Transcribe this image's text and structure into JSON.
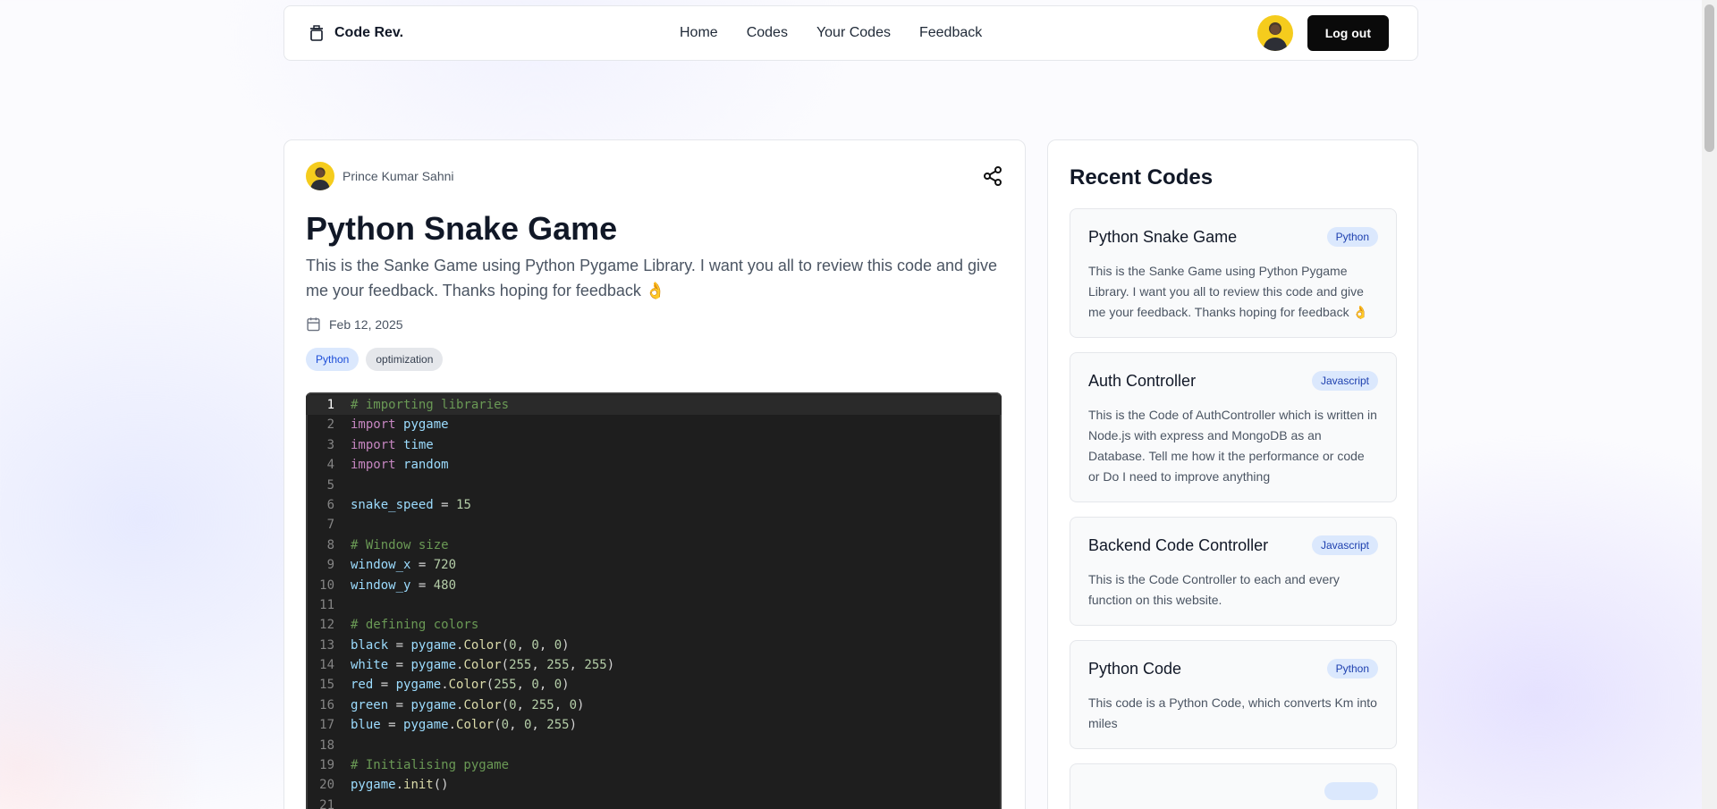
{
  "navbar": {
    "brand": "Code Rev.",
    "brand_icon": "trash-can-icon",
    "links": [
      "Home",
      "Codes",
      "Your Codes",
      "Feedback"
    ],
    "logout_label": "Log out"
  },
  "post": {
    "author": "Prince Kumar Sahni",
    "title": "Python Snake Game",
    "description": "This is the Sanke Game using Python Pygame Library. I want you all to review this code and give me your feedback. Thanks hoping for feedback 👌",
    "date": "Feb 12, 2025",
    "tags": [
      "Python",
      "optimization"
    ],
    "share_icon": "share-icon",
    "date_icon": "calendar-icon"
  },
  "code": {
    "active_line": 1,
    "lines": [
      "# importing libraries",
      "import pygame",
      "import time",
      "import random",
      "",
      "snake_speed = 15",
      "",
      "# Window size",
      "window_x = 720",
      "window_y = 480",
      "",
      "# defining colors",
      "black = pygame.Color(0, 0, 0)",
      "white = pygame.Color(255, 255, 255)",
      "red = pygame.Color(255, 0, 0)",
      "green = pygame.Color(0, 255, 0)",
      "blue = pygame.Color(0, 0, 255)",
      "",
      "# Initialising pygame",
      "pygame.init()",
      ""
    ]
  },
  "sidebar": {
    "title": "Recent Codes",
    "items": [
      {
        "title": "Python Snake Game",
        "language": "Python",
        "description": "This is the Sanke Game using Python Pygame Library. I want you all to review this code and give me your feedback. Thanks hoping for feedback 👌"
      },
      {
        "title": "Auth Controller",
        "language": "Javascript",
        "description": "This is the Code of AuthController which is written in Node.js with express and MongoDB as an Database. Tell me how it the performance or code or Do I need to improve anything"
      },
      {
        "title": "Backend Code Controller",
        "language": "Javascript",
        "description": "This is the Code Controller to each and every function on this website."
      },
      {
        "title": "Python Code",
        "language": "Python",
        "description": "This code is a Python Code, which converts Km into miles"
      }
    ]
  },
  "colors": {
    "primary_button": "#0a0a0a",
    "tag_blue_bg": "#dbe8fd",
    "tag_blue_text": "#1d4ed8",
    "editor_bg": "#1e1e1e",
    "avatar_bg": "#f5cc1d"
  }
}
